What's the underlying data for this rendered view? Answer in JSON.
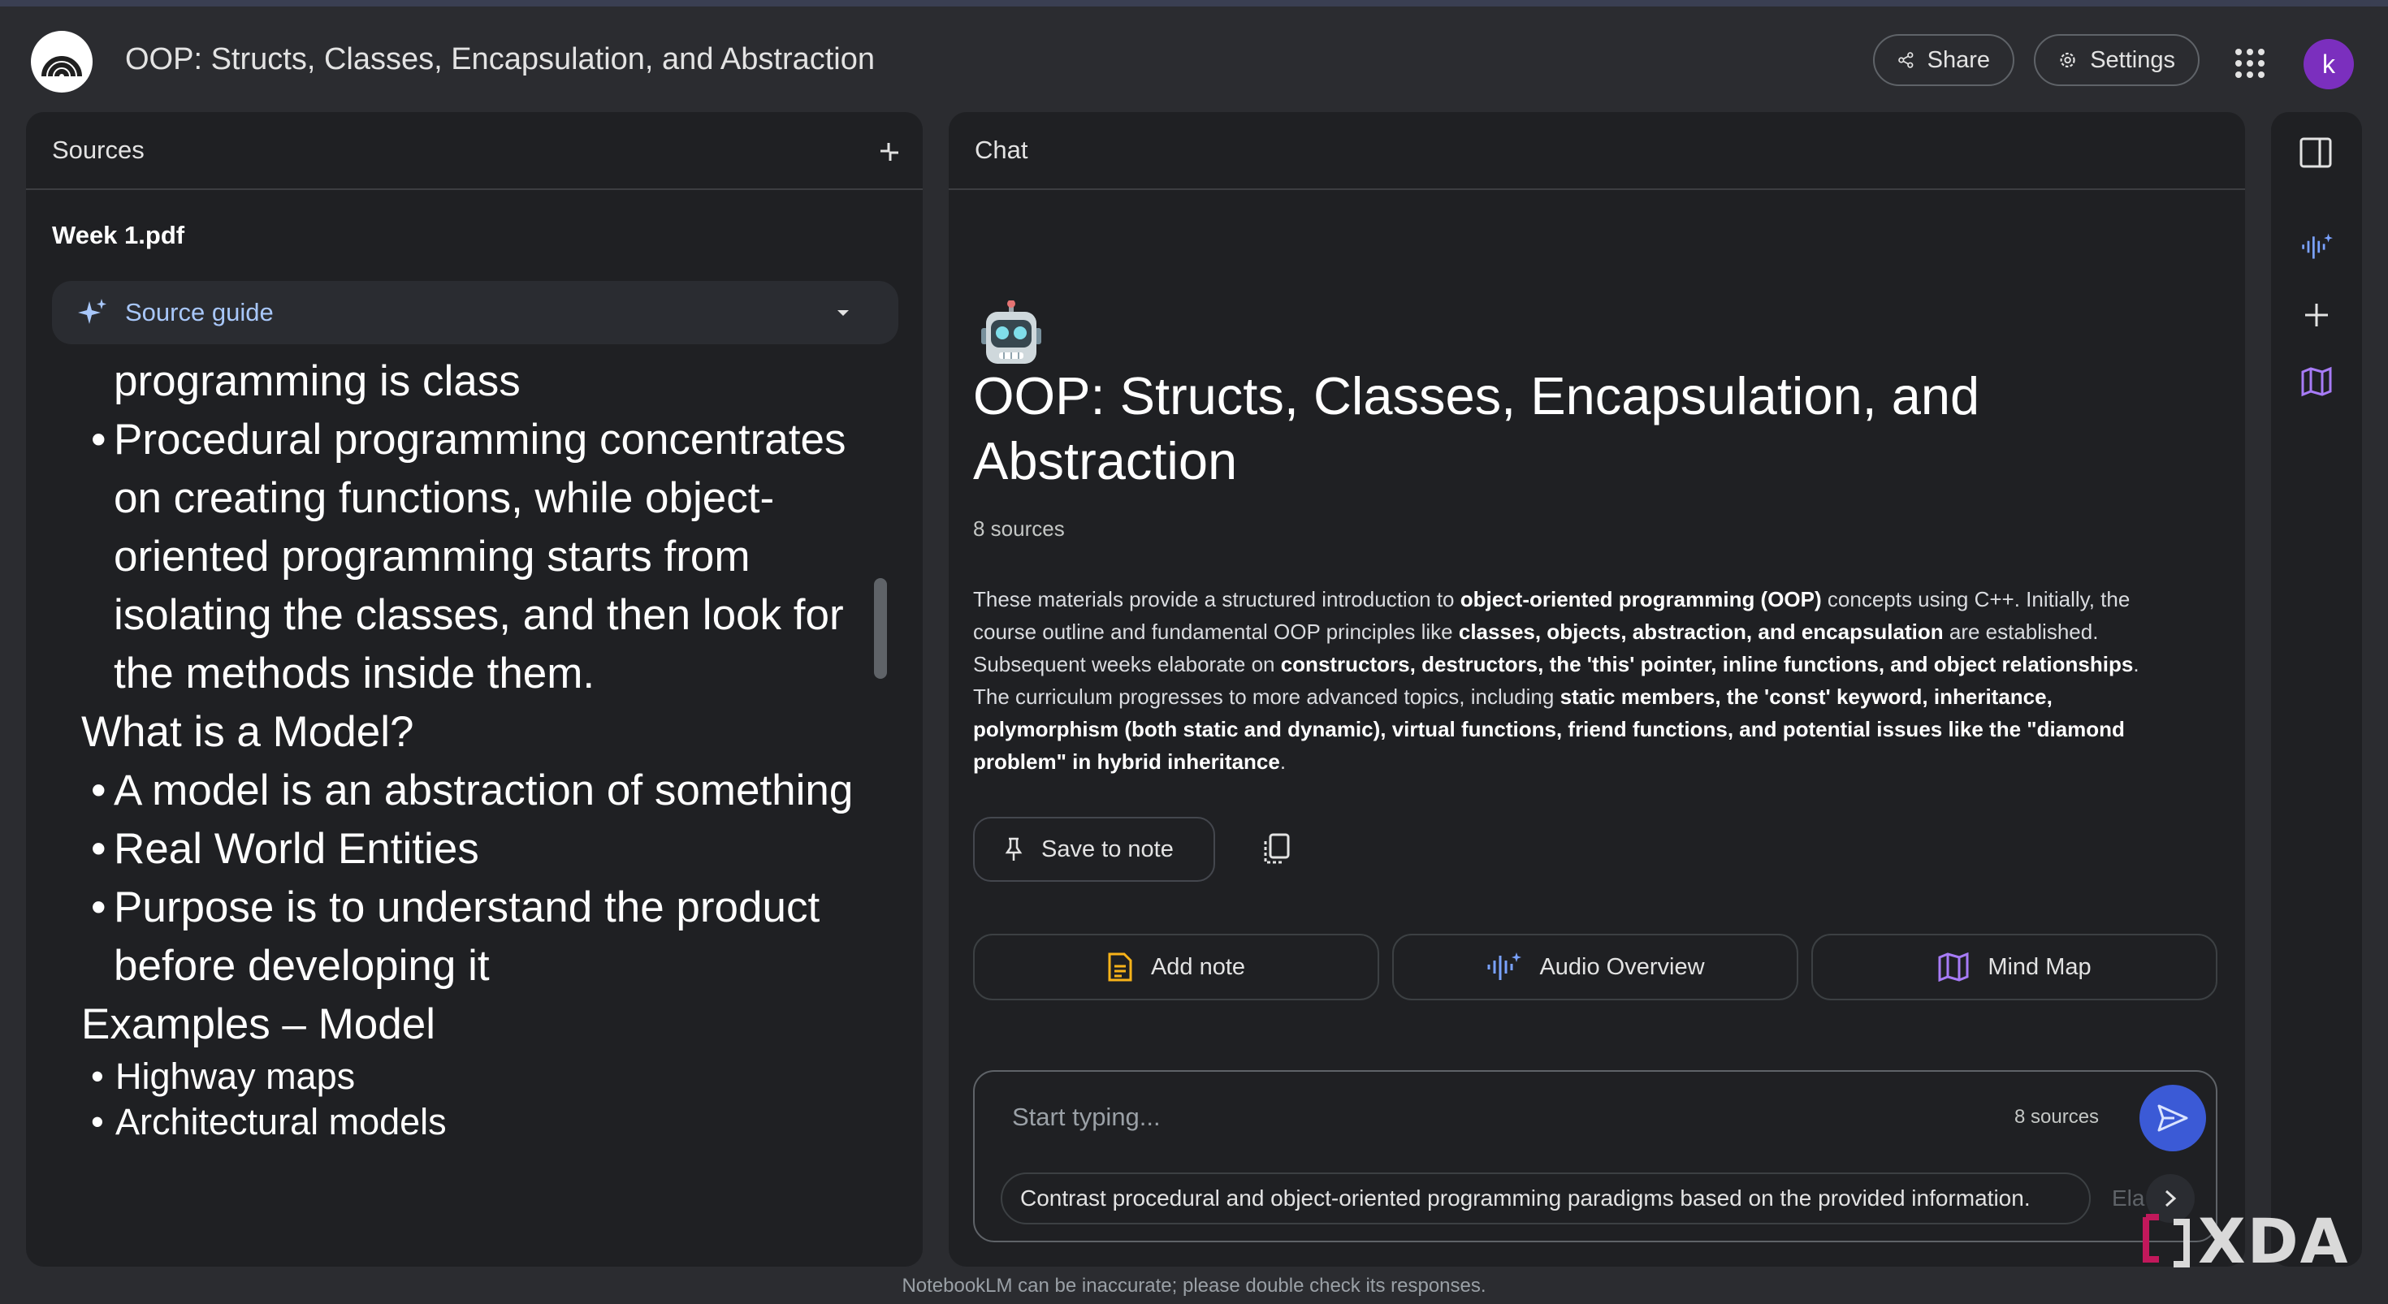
{
  "header": {
    "title": "OOP: Structs, Classes, Encapsulation, and Abstraction",
    "share_label": "Share",
    "settings_label": "Settings",
    "avatar_letter": "k"
  },
  "sources": {
    "title": "Sources",
    "file_name": "Week 1.pdf",
    "guide_label": "Source guide",
    "document_lines": [
      {
        "type": "cont",
        "text": "programming is class"
      },
      {
        "type": "bullet",
        "text": "Procedural programming concentrates on creating functions, while object-oriented programming starts from isolating the classes, and then look for the methods inside them."
      },
      {
        "type": "heading",
        "text": "What is a Model?"
      },
      {
        "type": "bullet",
        "text": "A model is an abstraction of something"
      },
      {
        "type": "bullet",
        "text": "Real World Entities"
      },
      {
        "type": "bullet",
        "text": "Purpose is to understand the product before developing it"
      },
      {
        "type": "heading",
        "text": "Examples – Model"
      },
      {
        "type": "bullet-sm",
        "text": "Highway maps"
      },
      {
        "type": "bullet-sm",
        "text": "Architectural models"
      }
    ]
  },
  "chat": {
    "title": "Chat",
    "notebook_title": "OOP: Structs, Classes, Encapsulation, and Abstraction",
    "source_count": "8 sources",
    "summary": {
      "s1": "These materials provide a structured introduction to ",
      "b1": "object-oriented programming (OOP)",
      "s2": " concepts using C++. Initially, the course outline and fundamental OOP principles like ",
      "b2": "classes, objects, abstraction, and encapsulation",
      "s3": " are established. Subsequent weeks elaborate on ",
      "b3": "constructors, destructors, the 'this' pointer, inline functions, and object relationships",
      "s4": ". The curriculum progresses to more advanced topics, including ",
      "b4": "static members, the 'const' keyword, inheritance, polymorphism (both static and dynamic), virtual functions, friend functions, and potential issues like the \"diamond problem\" in hybrid inheritance",
      "s5": "."
    },
    "save_note_label": "Save to note",
    "actions": {
      "add_note": "Add note",
      "audio_overview": "Audio Overview",
      "mind_map": "Mind Map"
    },
    "input": {
      "placeholder": "Start typing...",
      "source_count": "8 sources"
    },
    "suggestions": [
      "Contrast procedural and object-oriented programming paradigms based on the provided information.",
      "Ela"
    ]
  },
  "footer": {
    "disclaimer": "NotebookLM can be inaccurate; please double check its responses."
  },
  "watermark": "XDA",
  "colors": {
    "background": "#2b2c30",
    "panel": "#1f2023",
    "accent_blue": "#a8c7fa",
    "send_button": "#3b5ad6",
    "avatar": "#7b2fbe",
    "note_yellow": "#f9b319",
    "mindmap_purple": "#a77bf6"
  }
}
